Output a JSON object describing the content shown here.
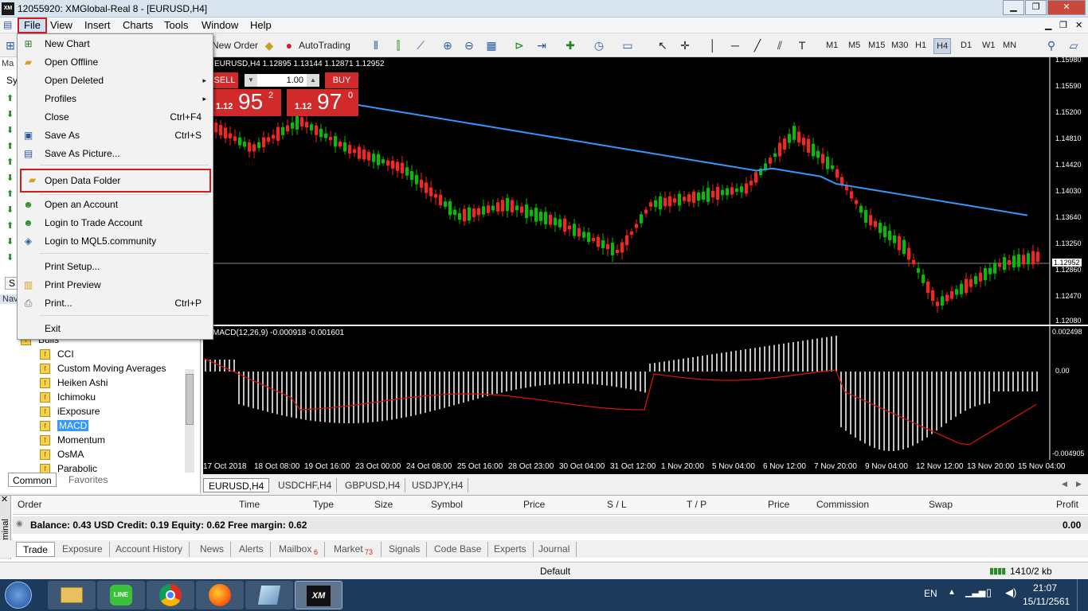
{
  "window": {
    "title": "12055920: XMGlobal-Real 8 - [EURUSD,H4]",
    "logo": "XM"
  },
  "menu": [
    "File",
    "View",
    "Insert",
    "Charts",
    "Tools",
    "Window",
    "Help"
  ],
  "toolbar": {
    "new_order": "New Order",
    "autotrading": "AutoTrading",
    "timeframes": [
      "M1",
      "M5",
      "M15",
      "M30",
      "H1",
      "H4",
      "D1",
      "W1",
      "MN"
    ],
    "active_tf": "H4"
  },
  "file_menu": [
    {
      "label": "New Chart",
      "shortcut": "",
      "icon": "new-chart-icon"
    },
    {
      "label": "Open Offline",
      "shortcut": "",
      "icon": "folder-open-icon"
    },
    {
      "label": "Open Deleted",
      "shortcut": "",
      "arrow": "▸",
      "icon": ""
    },
    {
      "label": "Profiles",
      "shortcut": "",
      "arrow": "▸",
      "icon": ""
    },
    {
      "label": "Close",
      "shortcut": "Ctrl+F4",
      "icon": ""
    },
    {
      "label": "Save As",
      "shortcut": "Ctrl+S",
      "icon": "save-icon"
    },
    {
      "label": "Save As Picture...",
      "shortcut": "",
      "icon": "picture-icon"
    },
    {
      "label": "Open Data Folder",
      "shortcut": "",
      "icon": "folder-icon",
      "highlight": true
    },
    {
      "label": "Open an Account",
      "shortcut": "",
      "icon": "account-icon"
    },
    {
      "label": "Login to Trade Account",
      "shortcut": "",
      "icon": "login-icon"
    },
    {
      "label": "Login to MQL5.community",
      "shortcut": "",
      "icon": "mql5-icon"
    },
    {
      "label": "Print Setup...",
      "shortcut": "",
      "icon": ""
    },
    {
      "label": "Print Preview",
      "shortcut": "",
      "icon": "print-preview-icon"
    },
    {
      "label": "Print...",
      "shortcut": "Ctrl+P",
      "icon": "print-icon"
    },
    {
      "label": "Exit",
      "shortcut": "",
      "icon": ""
    }
  ],
  "chart": {
    "symbol_info": "EURUSD,H4  1.12895 1.13144 1.12871 1.12952",
    "sell_label": "SELL",
    "buy_label": "BUY",
    "lot": "1.00",
    "sell_price_prefix": "1.12",
    "sell_price_big": "95",
    "sell_price_sup": "2",
    "buy_price_prefix": "1.12",
    "buy_price_big": "97",
    "buy_price_sup": "0",
    "price_levels": [
      "1.15980",
      "1.15590",
      "1.15200",
      "1.14810",
      "1.14420",
      "1.14030",
      "1.13640",
      "1.13250",
      "1.12860",
      "1.12470",
      "1.12080"
    ],
    "current_price": "1.12952",
    "macd_label": "MACD(12,26,9) -0.000918 -0.001601",
    "macd_levels": [
      "0.002498",
      "0.00",
      "-0.004905"
    ],
    "time_labels": [
      "17 Oct 2018",
      "18 Oct 08:00",
      "19 Oct 16:00",
      "23 Oct 00:00",
      "24 Oct 08:00",
      "25 Oct 16:00",
      "28 Oct 23:00",
      "30 Oct 04:00",
      "31 Oct 12:00",
      "1 Nov 20:00",
      "5 Nov 04:00",
      "6 Nov 12:00",
      "7 Nov 20:00",
      "9 Nov 04:00",
      "12 Nov 12:00",
      "13 Nov 20:00",
      "15 Nov 04:00"
    ],
    "colors": {
      "bull": "#00c000",
      "bear": "#ff2020",
      "ma": "#3399ff",
      "macd_signal": "#e01010",
      "macd_hist": "#c0c0c0"
    }
  },
  "chart_tabs": [
    "EURUSD,H4",
    "USDCHF,H4",
    "GBPUSD,H4",
    "USDJPY,H4"
  ],
  "navigator": {
    "items": [
      "Bulls",
      "CCI",
      "Custom Moving Averages",
      "Heiken Ashi",
      "Ichimoku",
      "iExposure",
      "MACD",
      "Momentum",
      "OsMA",
      "Parabolic"
    ],
    "selected": "MACD",
    "tabs": [
      "Common",
      "Favorites"
    ]
  },
  "terminal": {
    "headers": [
      "Order",
      "Time",
      "Type",
      "Size",
      "Symbol",
      "Price",
      "S / L",
      "T / P",
      "Price",
      "Commission",
      "Swap",
      "Profit"
    ],
    "balance_line": "Balance: 0.43 USD  Credit: 0.19  Equity: 0.62  Free margin: 0.62",
    "profit": "0.00",
    "side_label": "Terminal",
    "tabs": [
      "Trade",
      "Exposure",
      "Account History",
      "News",
      "Alerts",
      "Mailbox",
      "Market",
      "Signals",
      "Code Base",
      "Experts",
      "Journal"
    ],
    "mailbox_count": "6",
    "market_count": "73"
  },
  "status": {
    "profile": "Default",
    "traffic": "1410/2 kb"
  },
  "taskbar": {
    "lang": "EN",
    "time": "21:07",
    "date": "15/11/2561"
  }
}
